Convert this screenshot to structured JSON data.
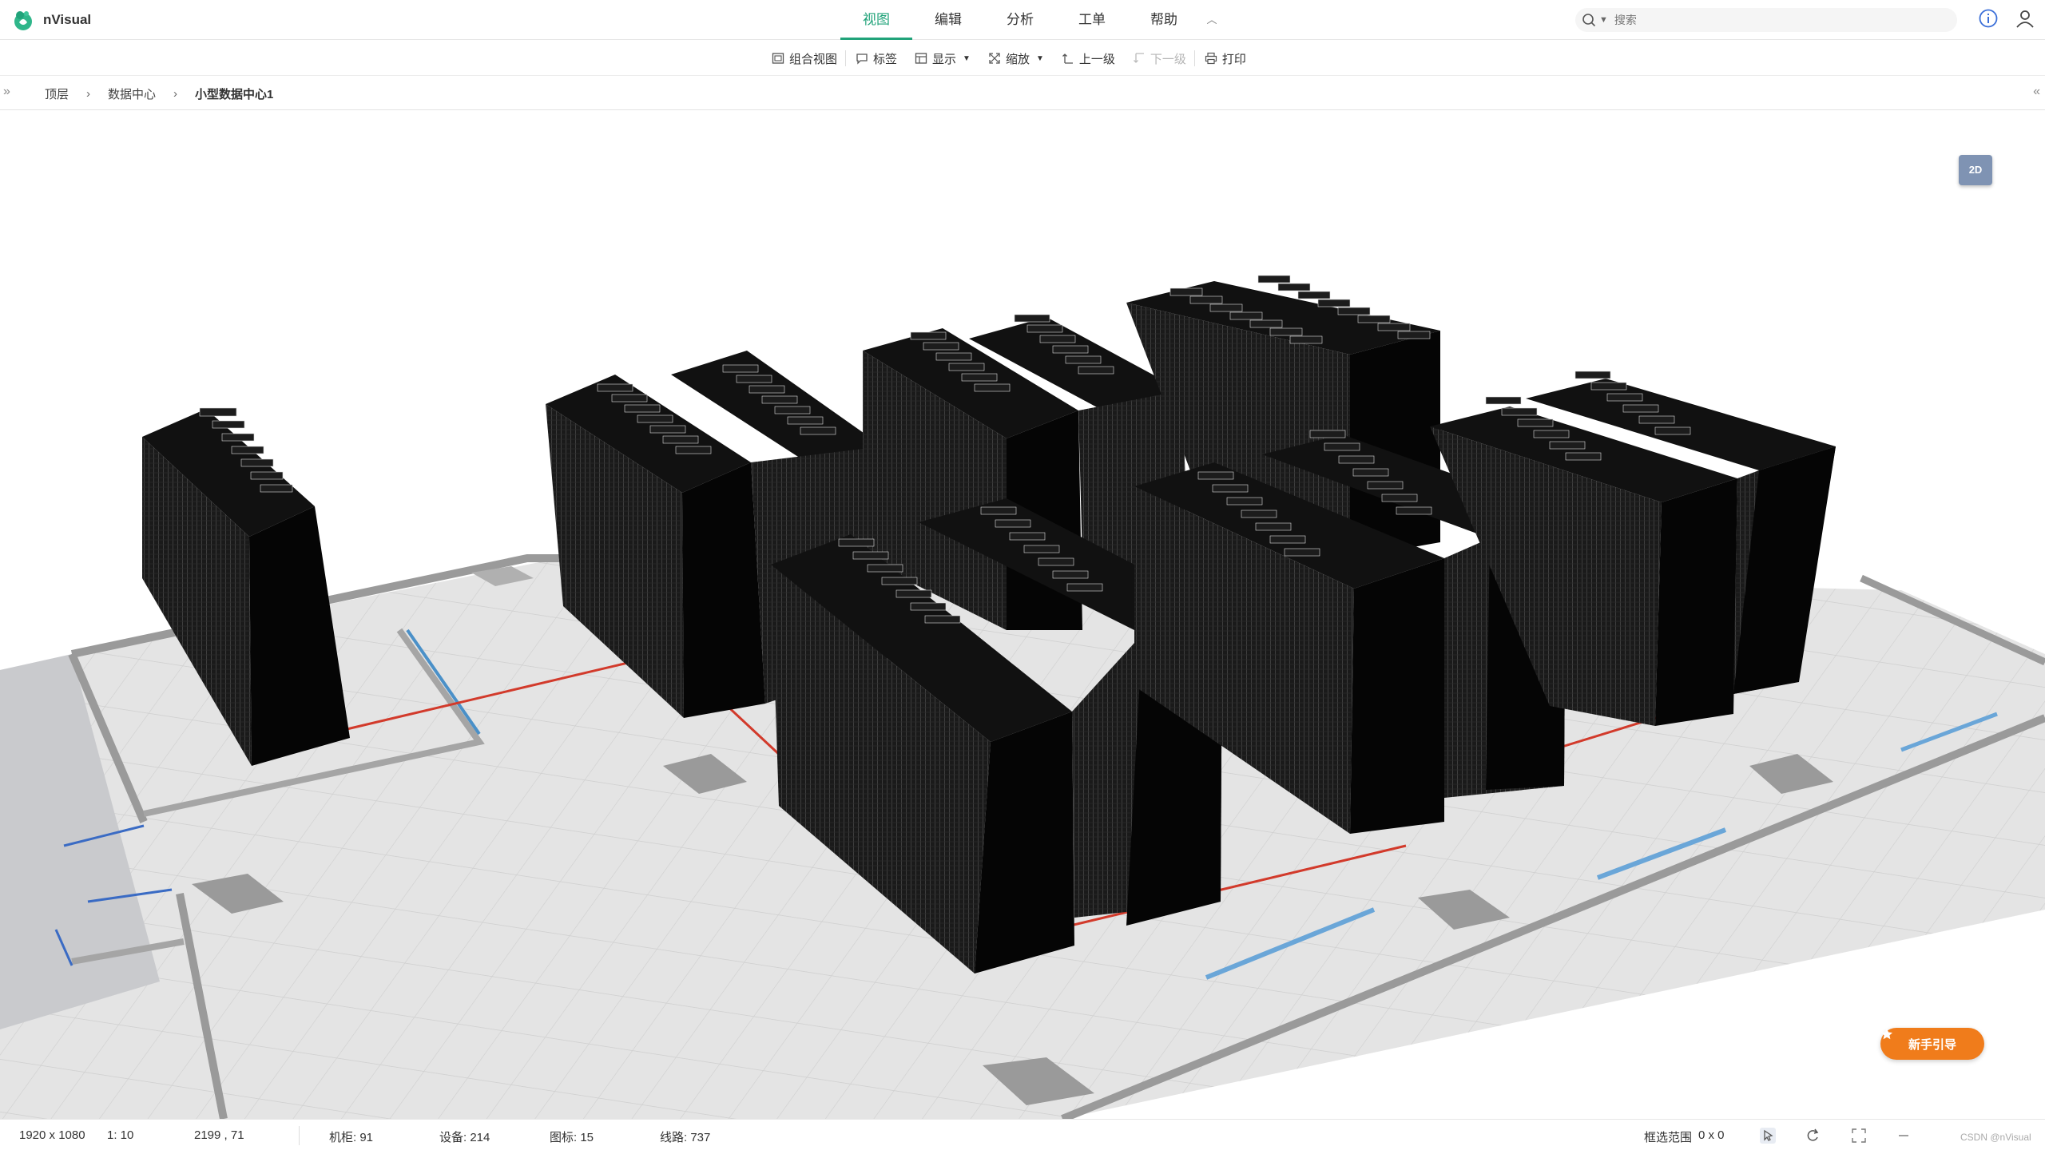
{
  "app": {
    "name": "nVisual"
  },
  "main_tabs": [
    {
      "label": "视图",
      "active": true
    },
    {
      "label": "编辑",
      "active": false
    },
    {
      "label": "分析",
      "active": false
    },
    {
      "label": "工单",
      "active": false
    },
    {
      "label": "帮助",
      "active": false
    }
  ],
  "search": {
    "placeholder": "搜索"
  },
  "toolbar": {
    "combo_view": "组合视图",
    "label": "标签",
    "display": "显示",
    "zoom": "缩放",
    "up_level": "上一级",
    "down_level": "下一级",
    "print": "打印"
  },
  "breadcrumb": {
    "items": [
      "顶层",
      "数据中心",
      "小型数据中心1"
    ]
  },
  "scene": {
    "view_toggle": "2D",
    "guide_button": "新手引导",
    "colors": {
      "accent": "#21a37a",
      "cabinet": "#050505",
      "floor": "#e1e1e1",
      "wall": "#9a9a9a",
      "power_line": "#d23a2b",
      "water_pipe": "#4a90c8",
      "guide": "#f07c1b"
    }
  },
  "status": {
    "resolution": "1920 x 1080",
    "scale": "1: 10",
    "coords": "2199 , 71",
    "cabinets": "机柜: 91",
    "devices": "设备: 214",
    "icons": "图标: 15",
    "lines": "线路: 737",
    "selection": "框选范围",
    "selection_value": "0 x 0"
  },
  "watermark": "CSDN @nVisual"
}
